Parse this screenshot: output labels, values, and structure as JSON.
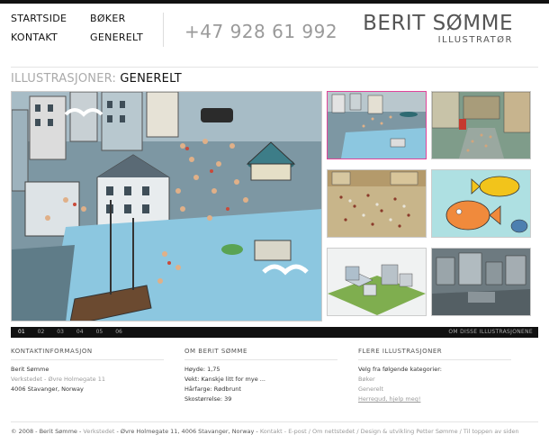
{
  "nav": {
    "items": [
      "STARTSIDE",
      "BØKER",
      "KONTAKT",
      "GENERELT"
    ]
  },
  "phone": "+47 928 61 992",
  "logo": {
    "name": "BERIT SØMME",
    "subtitle": "ILLUSTRATØR"
  },
  "heading": {
    "prefix": "ILLUSTRASJONER:",
    "current": "GENERELT"
  },
  "gallery": {
    "main_image": "city-square-illustration",
    "thumbnails": [
      "harbor-city-thumb",
      "city-street-crowd-thumb",
      "festival-crowd-thumb",
      "fish-illustration-thumb",
      "isometric-town-thumb",
      "grey-city-thumb"
    ],
    "active_thumbnail": 0,
    "pages": [
      "01",
      "02",
      "03",
      "04",
      "05",
      "06"
    ],
    "active_page": 0,
    "about_link": "OM DISSE ILLUSTRASJONENE"
  },
  "contact": {
    "title": "KONTAKTINFORMASJON",
    "name": "Berit Sømme",
    "address1": "Verkstedet - Øvre Holmegate 11",
    "address2": "4006 Stavanger, Norway"
  },
  "about": {
    "title": "OM BERIT SØMME",
    "lines": [
      "Høyde: 1,75",
      "Vekt: Kanskje litt for mye ...",
      "Hårfarge: Rødbrunt",
      "Skostørrelse: 39"
    ]
  },
  "more": {
    "title": "FLERE ILLUSTRASJONER",
    "intro": "Velg fra følgende kategorier:",
    "links": [
      "Bøker",
      "Generelt",
      "Herregud, hjelp meg!"
    ]
  },
  "footer": {
    "copyright": "© 2008 - Berit Sømme - ",
    "workshop": "Verkstedet",
    "address": " - Øvre Holmegate 11, 4006 Stavanger, Norway - ",
    "links": "Kontakt - E-post / Om nettstedet / Design & utvikling Petter Sømme / Til toppen av siden"
  }
}
